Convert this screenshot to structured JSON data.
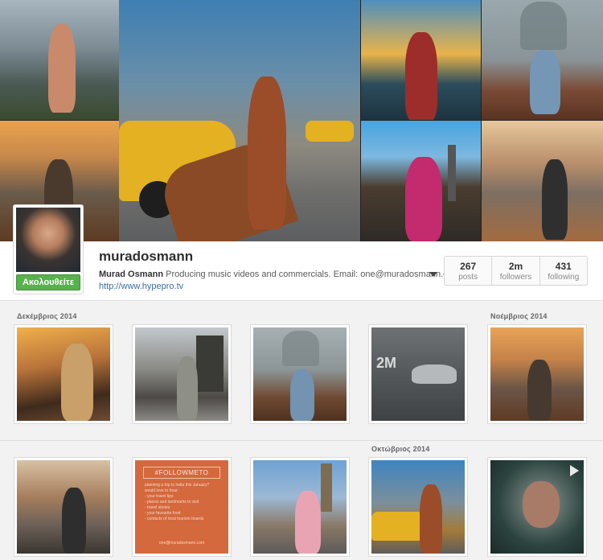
{
  "profile": {
    "username": "muradosmann",
    "full_name": "Murad Osmann",
    "bio": "Producing music videos and commercials. Email: one@muradosmann.com",
    "website": "http://www.hypepro.tv",
    "follow_label": "Ακολουθείτε"
  },
  "stats": [
    {
      "value": "267",
      "label": "posts"
    },
    {
      "value": "2m",
      "label": "followers"
    },
    {
      "value": "431",
      "label": "following"
    }
  ],
  "feed": {
    "months": [
      "Δεκέμβριος 2014",
      "Νοέμβριος 2014",
      "Οκτώβριος 2014"
    ],
    "wall_text": "2M",
    "followme_post": {
      "tag": "#FOLLOWMETO",
      "lines": [
        "planning a trip to India this January?",
        "would love to hear:",
        "- your travel tips",
        "- places and landmarks to visit",
        "- travel stories",
        "- your favourite food",
        "- contacts of local tourism boards"
      ],
      "email": "one@muradosmann.com"
    }
  },
  "colors": {
    "follow_green": "#58b04f",
    "link_blue": "#3a6ea5",
    "followme_orange": "#d4693e"
  },
  "icons": {
    "bio_toggle": "caret-down-icon",
    "video": "play-icon"
  }
}
